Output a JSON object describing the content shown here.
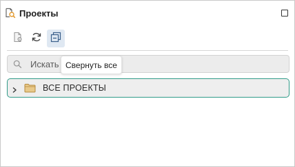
{
  "panel": {
    "title": "Проекты",
    "title_icon": "projects-search-icon",
    "maximize_icon": "maximize-icon"
  },
  "toolbar": {
    "buttons": [
      {
        "icon": "project-settings-icon",
        "active": false
      },
      {
        "icon": "refresh-icon",
        "active": false
      },
      {
        "icon": "collapse-all-icon",
        "active": true
      }
    ]
  },
  "search": {
    "placeholder": "Искать",
    "value": "",
    "icon": "search-icon"
  },
  "tooltip": {
    "text": "Свернуть все"
  },
  "tree": {
    "items": [
      {
        "label": "ВСЕ ПРОЕКТЫ",
        "expanded": false,
        "icon": "folder-icon",
        "selected": true
      }
    ]
  },
  "colors": {
    "selected_border": "#2f9a87",
    "active_button_bg": "#dfe8f2",
    "folder": "#c9a35a"
  }
}
